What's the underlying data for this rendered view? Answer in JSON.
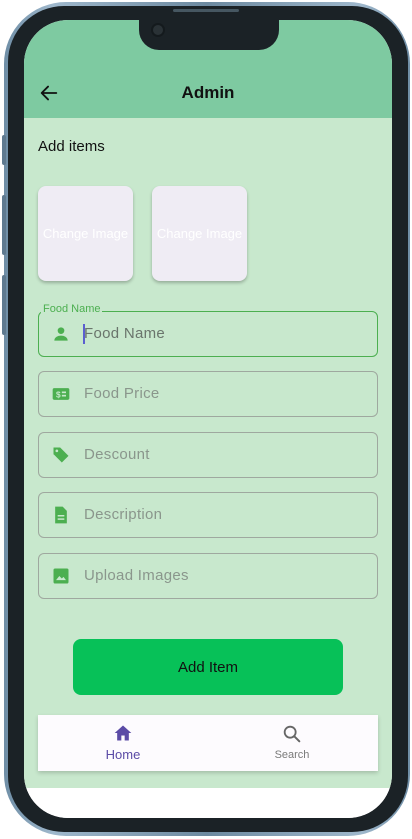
{
  "appbar": {
    "title": "Admin",
    "back_icon": "arrow-left-icon"
  },
  "section": {
    "title": "Add items"
  },
  "images": [
    {
      "label": "Change Image"
    },
    {
      "label": "Change Image"
    }
  ],
  "fields": [
    {
      "floating_label": "Food Name",
      "placeholder": "Food Name",
      "icon": "person-icon",
      "focused": true
    },
    {
      "placeholder": "Food Price",
      "icon": "price-tag-icon"
    },
    {
      "placeholder": "Descount",
      "icon": "discount-tag-icon"
    },
    {
      "placeholder": "Description",
      "icon": "document-icon"
    },
    {
      "placeholder": "Upload Images",
      "icon": "image-icon"
    }
  ],
  "submit": {
    "label": "Add Item"
  },
  "bottom_nav": {
    "items": [
      {
        "label": "Home",
        "icon": "home-icon",
        "active": true
      },
      {
        "label": "Search",
        "icon": "search-icon",
        "active": false
      }
    ]
  },
  "colors": {
    "appbar": "#7ecaa1",
    "background": "#c8e8cd",
    "accent_green": "#4caf50",
    "button": "#07c158",
    "nav_active": "#5b4ba6"
  }
}
